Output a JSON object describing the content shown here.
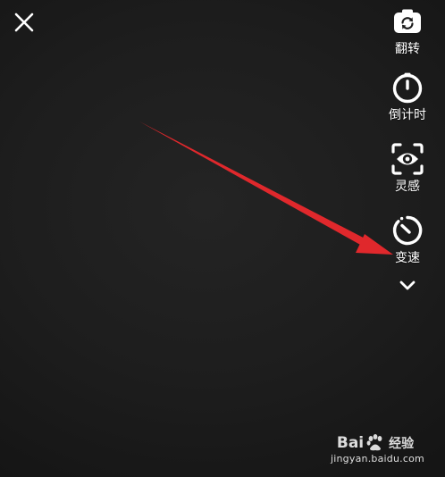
{
  "close": {
    "icon": "close-icon"
  },
  "toolbar": {
    "items": [
      {
        "label": "翻转",
        "icon": "camera-flip-icon"
      },
      {
        "label": "倒计时",
        "icon": "timer-icon"
      },
      {
        "label": "灵感",
        "icon": "eye-icon"
      },
      {
        "label": "变速",
        "icon": "speed-icon"
      }
    ],
    "more_icon": "chevron-down-icon"
  },
  "annotation": {
    "color": "#e0282c"
  },
  "watermark": {
    "brand_left": "Bai",
    "brand_right": "经验",
    "url": "jingyan.baidu.com"
  }
}
